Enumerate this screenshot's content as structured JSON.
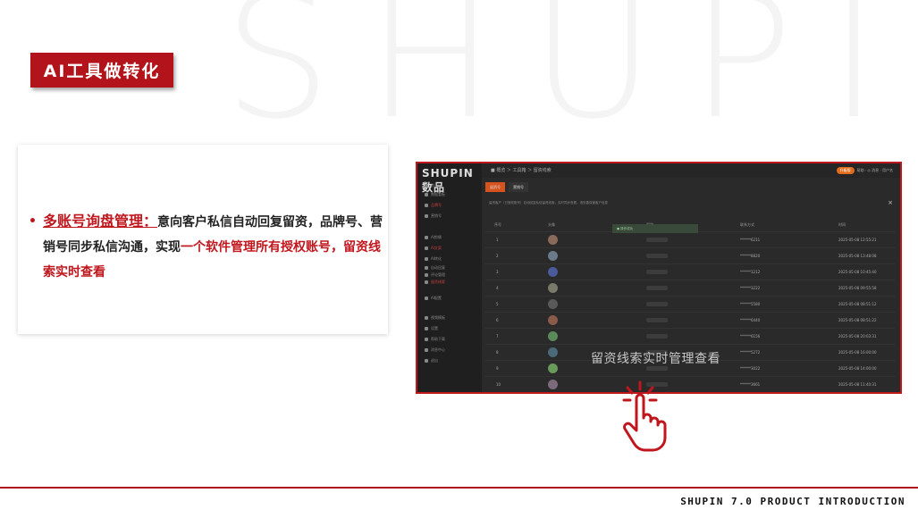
{
  "watermark": "SHUPIN",
  "title_badge": "AI工具做转化",
  "feature": {
    "heading": "多账号询盘管理：",
    "text_1": "意向客户私信自动回复留资，品牌号、营销号同步私信沟通，实现",
    "text_red": "一个软件管理所有授权账号，留资线索实时查看"
  },
  "screenshot": {
    "logo": "SHUPIN 数品",
    "breadcrumb": "■ 概览 ＞ 工具箱 ＞ 留资线索",
    "top_right_pill": "升级版",
    "top_right_text": "帮助 · ◎ 消息 · 用户名",
    "tabs": [
      "留资号",
      "营销号"
    ],
    "notice": "留资客户（已授权账号）自动回复私信留资线索，实时同步查看，请妥善保管客户信息",
    "close": "×",
    "sidebar_items": [
      {
        "label": "首页",
        "red": false
      },
      {
        "label": "数据看板",
        "red": false
      },
      {
        "label": "品牌号",
        "red": true
      },
      {
        "label": "营销号",
        "red": false
      },
      {
        "label": "AI剪辑",
        "red": false
      },
      {
        "label": "AI文案",
        "red": true
      },
      {
        "label": "AI转化",
        "red": false
      },
      {
        "label": "自动回复",
        "red": false
      },
      {
        "label": "评论管理",
        "red": false
      },
      {
        "label": "留资线索",
        "red": true
      },
      {
        "label": "AI配置",
        "red": false
      },
      {
        "label": "视频模板",
        "red": false
      },
      {
        "label": "设置",
        "red": false
      },
      {
        "label": "帮助下载",
        "red": false
      },
      {
        "label": "消息中心",
        "red": false
      },
      {
        "label": "退出",
        "red": false
      }
    ],
    "columns": [
      "序号",
      "头像",
      "昵称",
      "联系方式",
      "时间"
    ],
    "popup": "● 操作成功",
    "rows": [
      {
        "no": "1",
        "phone": "******6211",
        "time": "2025-05-08 12:55:21"
      },
      {
        "no": "2",
        "phone": "******8820",
        "time": "2025-05-08 13:48:08"
      },
      {
        "no": "3",
        "phone": "******1212",
        "time": "2025-05-08 10:45:40"
      },
      {
        "no": "4",
        "phone": "******3222",
        "time": "2025-05-08 09:55:58"
      },
      {
        "no": "5",
        "phone": "******5580",
        "time": "2025-05-08 08:51:12"
      },
      {
        "no": "6",
        "phone": "******6440",
        "time": "2025-05-08 08:51:22"
      },
      {
        "no": "7",
        "phone": "******6156",
        "time": "2025-05-08 20:03:31"
      },
      {
        "no": "8",
        "phone": "******5272",
        "time": "2025-05-08 16:00:00"
      },
      {
        "no": "9",
        "phone": "******3022",
        "time": "2025-05-08 14:00:00"
      },
      {
        "no": "10",
        "phone": "******3661",
        "time": "2025-05-08 11:40:31"
      }
    ],
    "overlay_caption": "留资线索实时管理查看"
  },
  "footer": "SHUPIN 7.0 PRODUCT INTRODUCTION",
  "colors": {
    "brand_red": "#b3141b",
    "accent_orange": "#d6531d"
  }
}
